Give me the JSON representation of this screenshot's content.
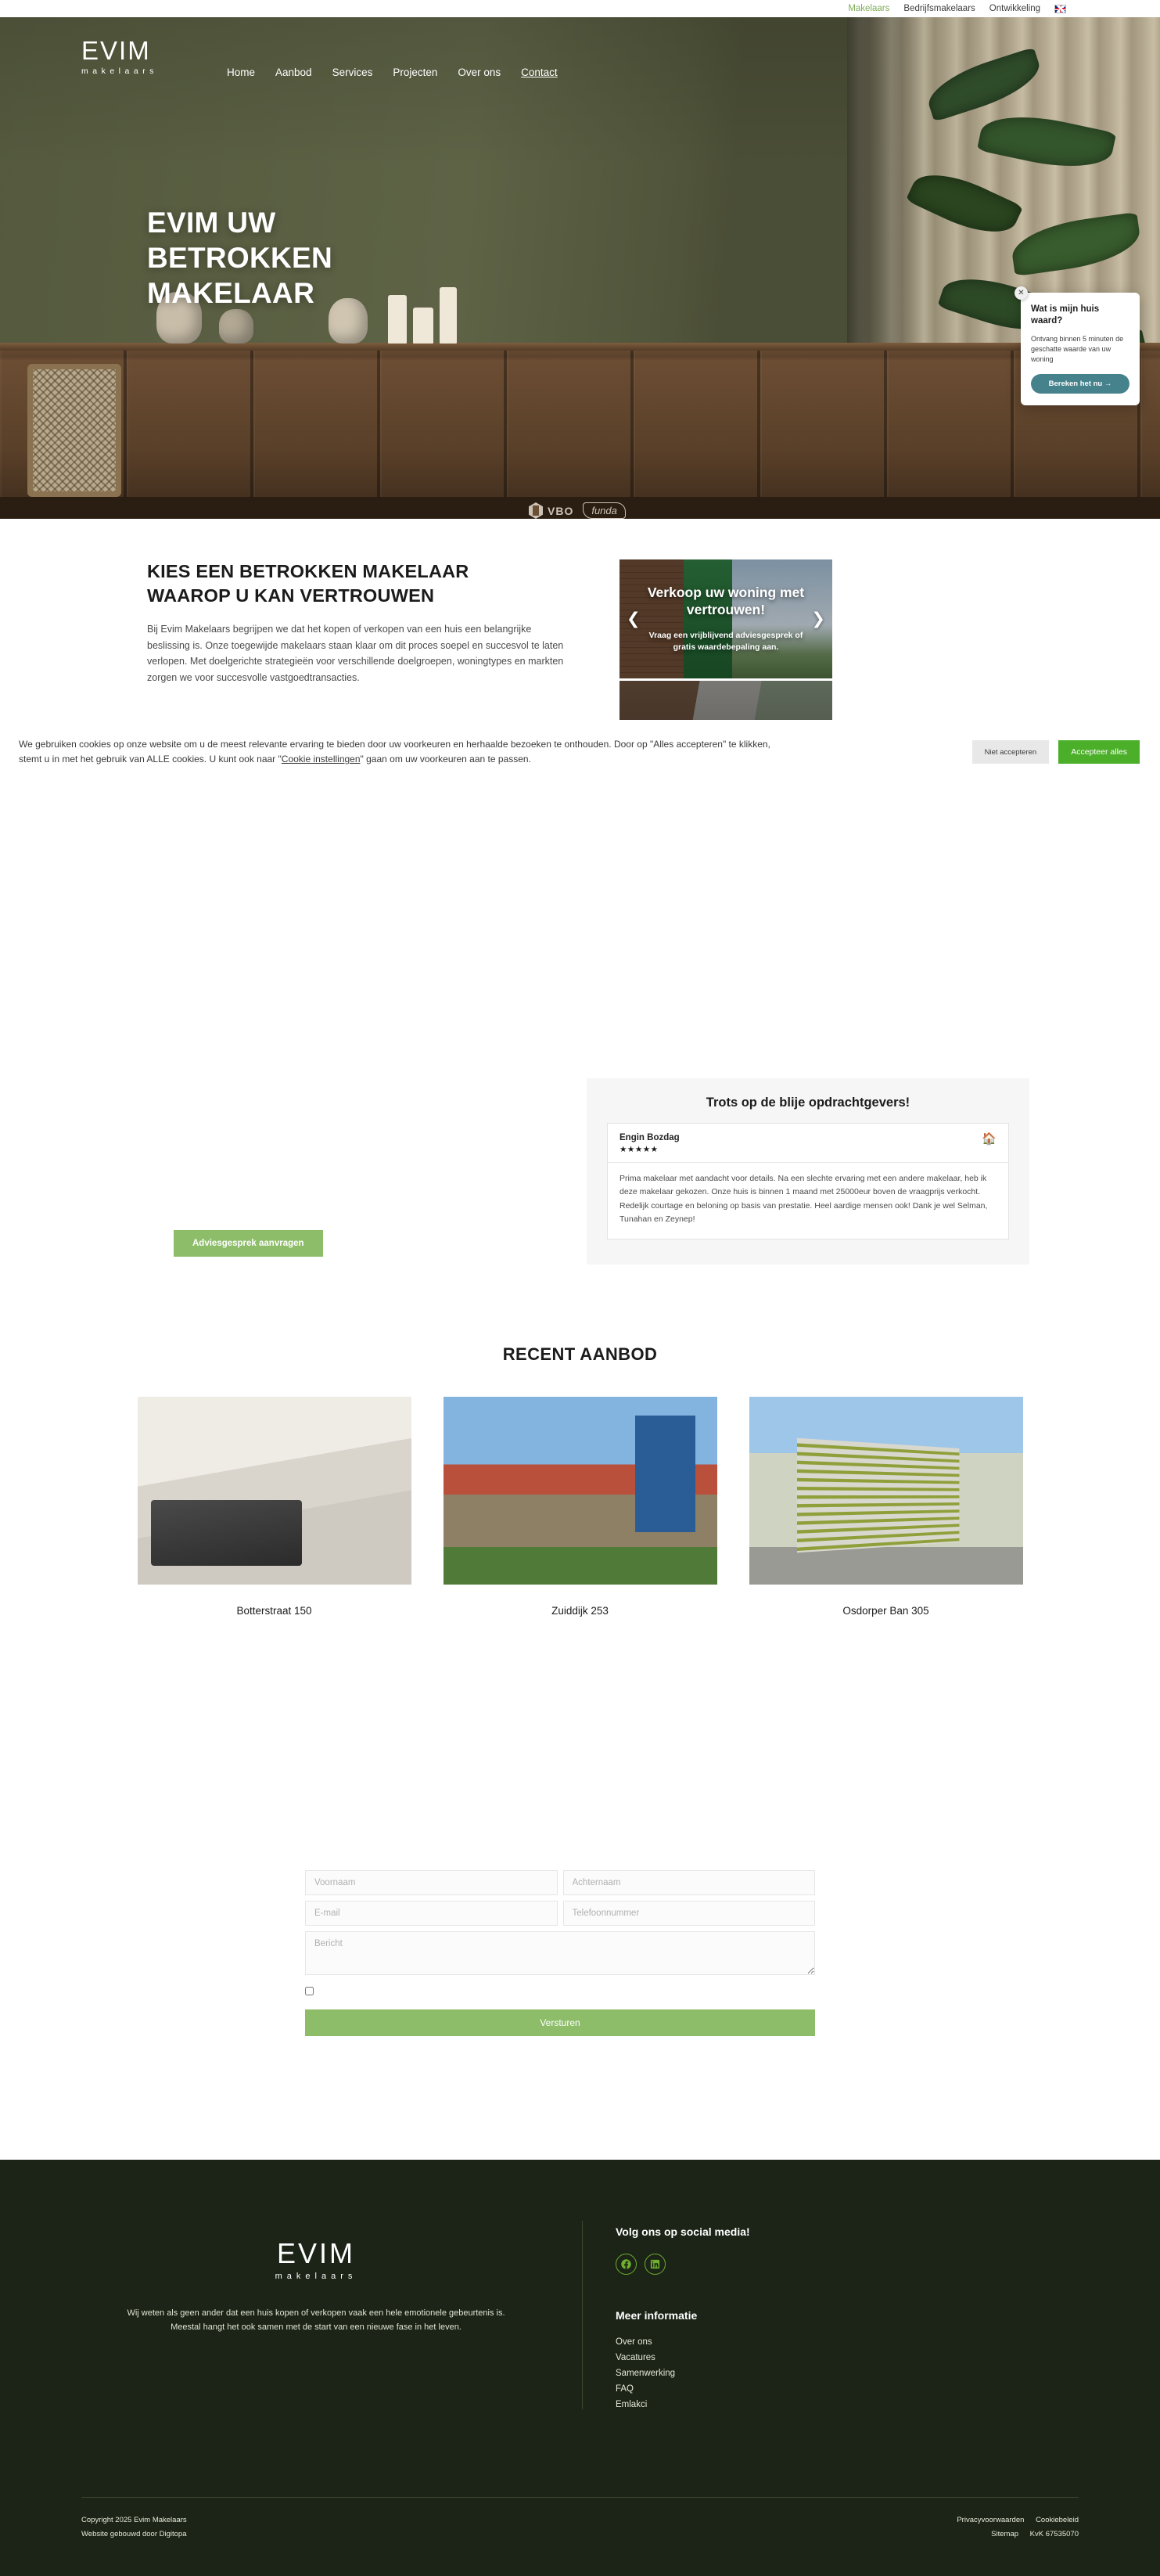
{
  "topbar": {
    "links": [
      {
        "label": "Makelaars",
        "active": true
      },
      {
        "label": "Bedrijfsmakelaars",
        "active": false
      },
      {
        "label": "Ontwikkeling",
        "active": false
      }
    ],
    "language_icon": "uk-flag-icon"
  },
  "hero": {
    "logo_main": "EVIM",
    "logo_sub": "makelaars",
    "nav": [
      {
        "label": "Home",
        "current": false
      },
      {
        "label": "Aanbod",
        "current": false
      },
      {
        "label": "Services",
        "current": false
      },
      {
        "label": "Projecten",
        "current": false
      },
      {
        "label": "Over ons",
        "current": false
      },
      {
        "label": "Contact",
        "current": true
      }
    ],
    "title_line1": "EVIM UW",
    "title_line2": "BETROKKEN",
    "title_line3": "MAKELAAR",
    "badges": {
      "vbo": "VBO",
      "funda": "funda"
    }
  },
  "value_widget": {
    "title": "Wat is mijn huis waard?",
    "body": "Ontvang binnen 5 minuten de geschatte waarde van uw woning",
    "cta": "Bereken het nu →",
    "close_icon": "close-icon",
    "accent_color": "#45828b"
  },
  "intro": {
    "heading_line1": "KIES EEN BETROKKEN MAKELAAR",
    "heading_line2": "WAAROP U KAN VERTROUWEN",
    "paragraph": "Bij Evim Makelaars begrijpen we dat het kopen of verkopen van een huis een belangrijke beslissing is. Onze toegewijde makelaars staan klaar om dit proces soepel en succesvol te laten verlopen. Met doelgerichte strategieën voor verschillende doelgroepen, woningtypes en markten zorgen we voor succesvolle vastgoedtransacties."
  },
  "slider": {
    "headline": "Verkoop uw woning met vertrouwen!",
    "subline": "Vraag een vrijblijvend adviesgesprek of gratis waardebepaling aan.",
    "prev_icon": "chevron-left-icon",
    "next_icon": "chevron-right-icon"
  },
  "cookie_banner": {
    "text_part1": "We gebruiken cookies op onze website om u de meest relevante ervaring te bieden door uw voorkeuren en herhaalde bezoeken te onthouden. Door op \"Alles accepteren\" te klikken, stemt u in met het gebruik van ALLE cookies. U kunt ook naar \"",
    "settings_link": "Cookie instellingen",
    "text_part2": "\" gaan om uw voorkeuren aan te passen.",
    "decline_label": "Niet accepteren",
    "accept_label": "Accepteer alles",
    "accept_color": "#4caf2a"
  },
  "testimonials": {
    "heading": "Trots op de blije opdrachtgevers!",
    "review": {
      "name": "Engin Bozdag",
      "stars": "★★★★★",
      "rating": 5,
      "icon": "house-icon",
      "body": "Prima makelaar met aandacht voor details. Na een slechte ervaring met een andere makelaar, heb ik deze makelaar gekozen. Onze huis is binnen 1 maand met 25000eur boven de vraagprijs verkocht. Redelijk courtage en beloning op basis van prestatie. Heel aardige mensen ook! Dank je wel Selman, Tunahan en Zeynep!"
    }
  },
  "advies_button": {
    "label": "Adviesgesprek aanvragen",
    "color": "#8dbd69"
  },
  "aanbod": {
    "heading": "RECENT AANBOD",
    "items": [
      {
        "title": "Botterstraat 150",
        "image": "living-room-photo"
      },
      {
        "title": "Zuiddijk 253",
        "image": "house-exterior-photo"
      },
      {
        "title": "Osdorper Ban 305",
        "image": "apartment-building-photo"
      }
    ]
  },
  "contact_form": {
    "firstname_placeholder": "Voornaam",
    "lastname_placeholder": "Achternaam",
    "email_placeholder": "E-mail",
    "phone_placeholder": "Telefoonnummer",
    "message_placeholder": "Bericht",
    "consent_checked": false,
    "submit_label": "Versturen",
    "submit_color": "#8dbd69"
  },
  "footer": {
    "logo_main": "EVIM",
    "logo_sub": "makelaars",
    "description": "Wij weten als geen ander dat een huis kopen of verkopen vaak een hele emotionele gebeurtenis is. Meestal hangt het ook samen met de start van een nieuwe fase in het leven.",
    "social_heading": "Volg ons op social media!",
    "socials": [
      {
        "name": "facebook-icon"
      },
      {
        "name": "linkedin-icon"
      }
    ],
    "info_heading": "Meer informatie",
    "info_links": [
      {
        "label": "Over ons"
      },
      {
        "label": "Vacatures"
      },
      {
        "label": "Samenwerking"
      },
      {
        "label": "FAQ"
      },
      {
        "label": "Emlakci"
      }
    ],
    "bottom": {
      "copyright": "Copyright 2025 Evim Makelaars",
      "built_by": "Website gebouwd door Digitopa",
      "privacy": "Privacyvoorwaarden",
      "cookie_policy": "Cookiebeleid",
      "sitemap": "Sitemap",
      "kvk": "KvK 67535070"
    }
  }
}
